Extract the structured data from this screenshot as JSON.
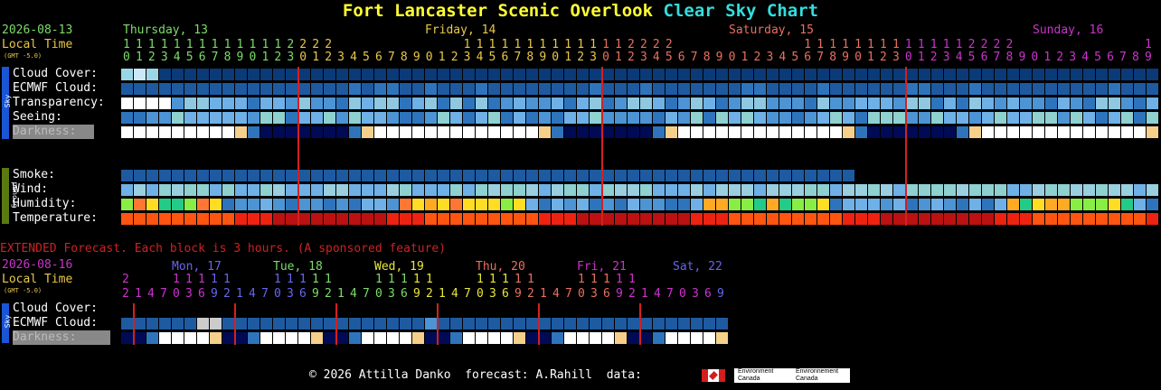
{
  "title": {
    "site": "Fort Lancaster Scenic Overlook",
    "chart": "Clear Sky Chart"
  },
  "colors": {
    "site": "#ffff33",
    "chart": "#33dddd",
    "date": "#7ddc6a",
    "local": "#e8c84a",
    "purple": "#cc33cc",
    "red": "#cc2222"
  },
  "main": {
    "date": "2026-08-13",
    "local_time": "Local Time",
    "gmt": "(GMT -5.0)",
    "days": [
      {
        "label": "Thursday, 13",
        "color": "#7ddc6a"
      },
      {
        "label": "Friday, 14",
        "color": "#e8c84a"
      },
      {
        "label": "Saturday, 15",
        "color": "#e87060"
      },
      {
        "label": "Sunday, 16",
        "color": "#cc33cc"
      }
    ],
    "hours_tens": "11111111111112222          11111111111112222          11111111111112222          1111111111",
    "hours_ones": "0123456789012301234567890123456789012301234567890123456789012301234567890123456789",
    "sky_rows": [
      "Cloud Cover:",
      "ECMWF Cloud:",
      "Transparency:",
      "Seeing:",
      "Darkness:"
    ],
    "ground_rows": [
      "Smoke:",
      "Wind:",
      "Humidity:",
      "Temperature:"
    ],
    "sky_tag": "Sky",
    "ground_tag": "Ground"
  },
  "extended": {
    "heading": "EXTENDED Forecast. Each block is 3 hours. (A sponsored feature)",
    "date": "2026-08-16",
    "local_time": "Local Time",
    "gmt": "(GMT -5.0)",
    "days": [
      {
        "label": "Mon, 17",
        "color": "#6666ee"
      },
      {
        "label": "Tue, 18",
        "color": "#7ddc6a"
      },
      {
        "label": "Wed, 19",
        "color": "#e8e83a"
      },
      {
        "label": "Thu, 20",
        "color": "#e87060"
      },
      {
        "label": "Fri, 21",
        "color": "#cc33cc"
      },
      {
        "label": "Sat, 22",
        "color": "#6666ee"
      }
    ],
    "rows": [
      "Cloud Cover:",
      "ECMWF Cloud:",
      "Darkness:"
    ],
    "sky_tag": "Sky"
  },
  "footer": {
    "copyright": "© 2026 Attilla Danko  forecast: A.Rahill  data:",
    "logo1": "Environment Canada",
    "logo2": "Environnement Canada"
  }
}
